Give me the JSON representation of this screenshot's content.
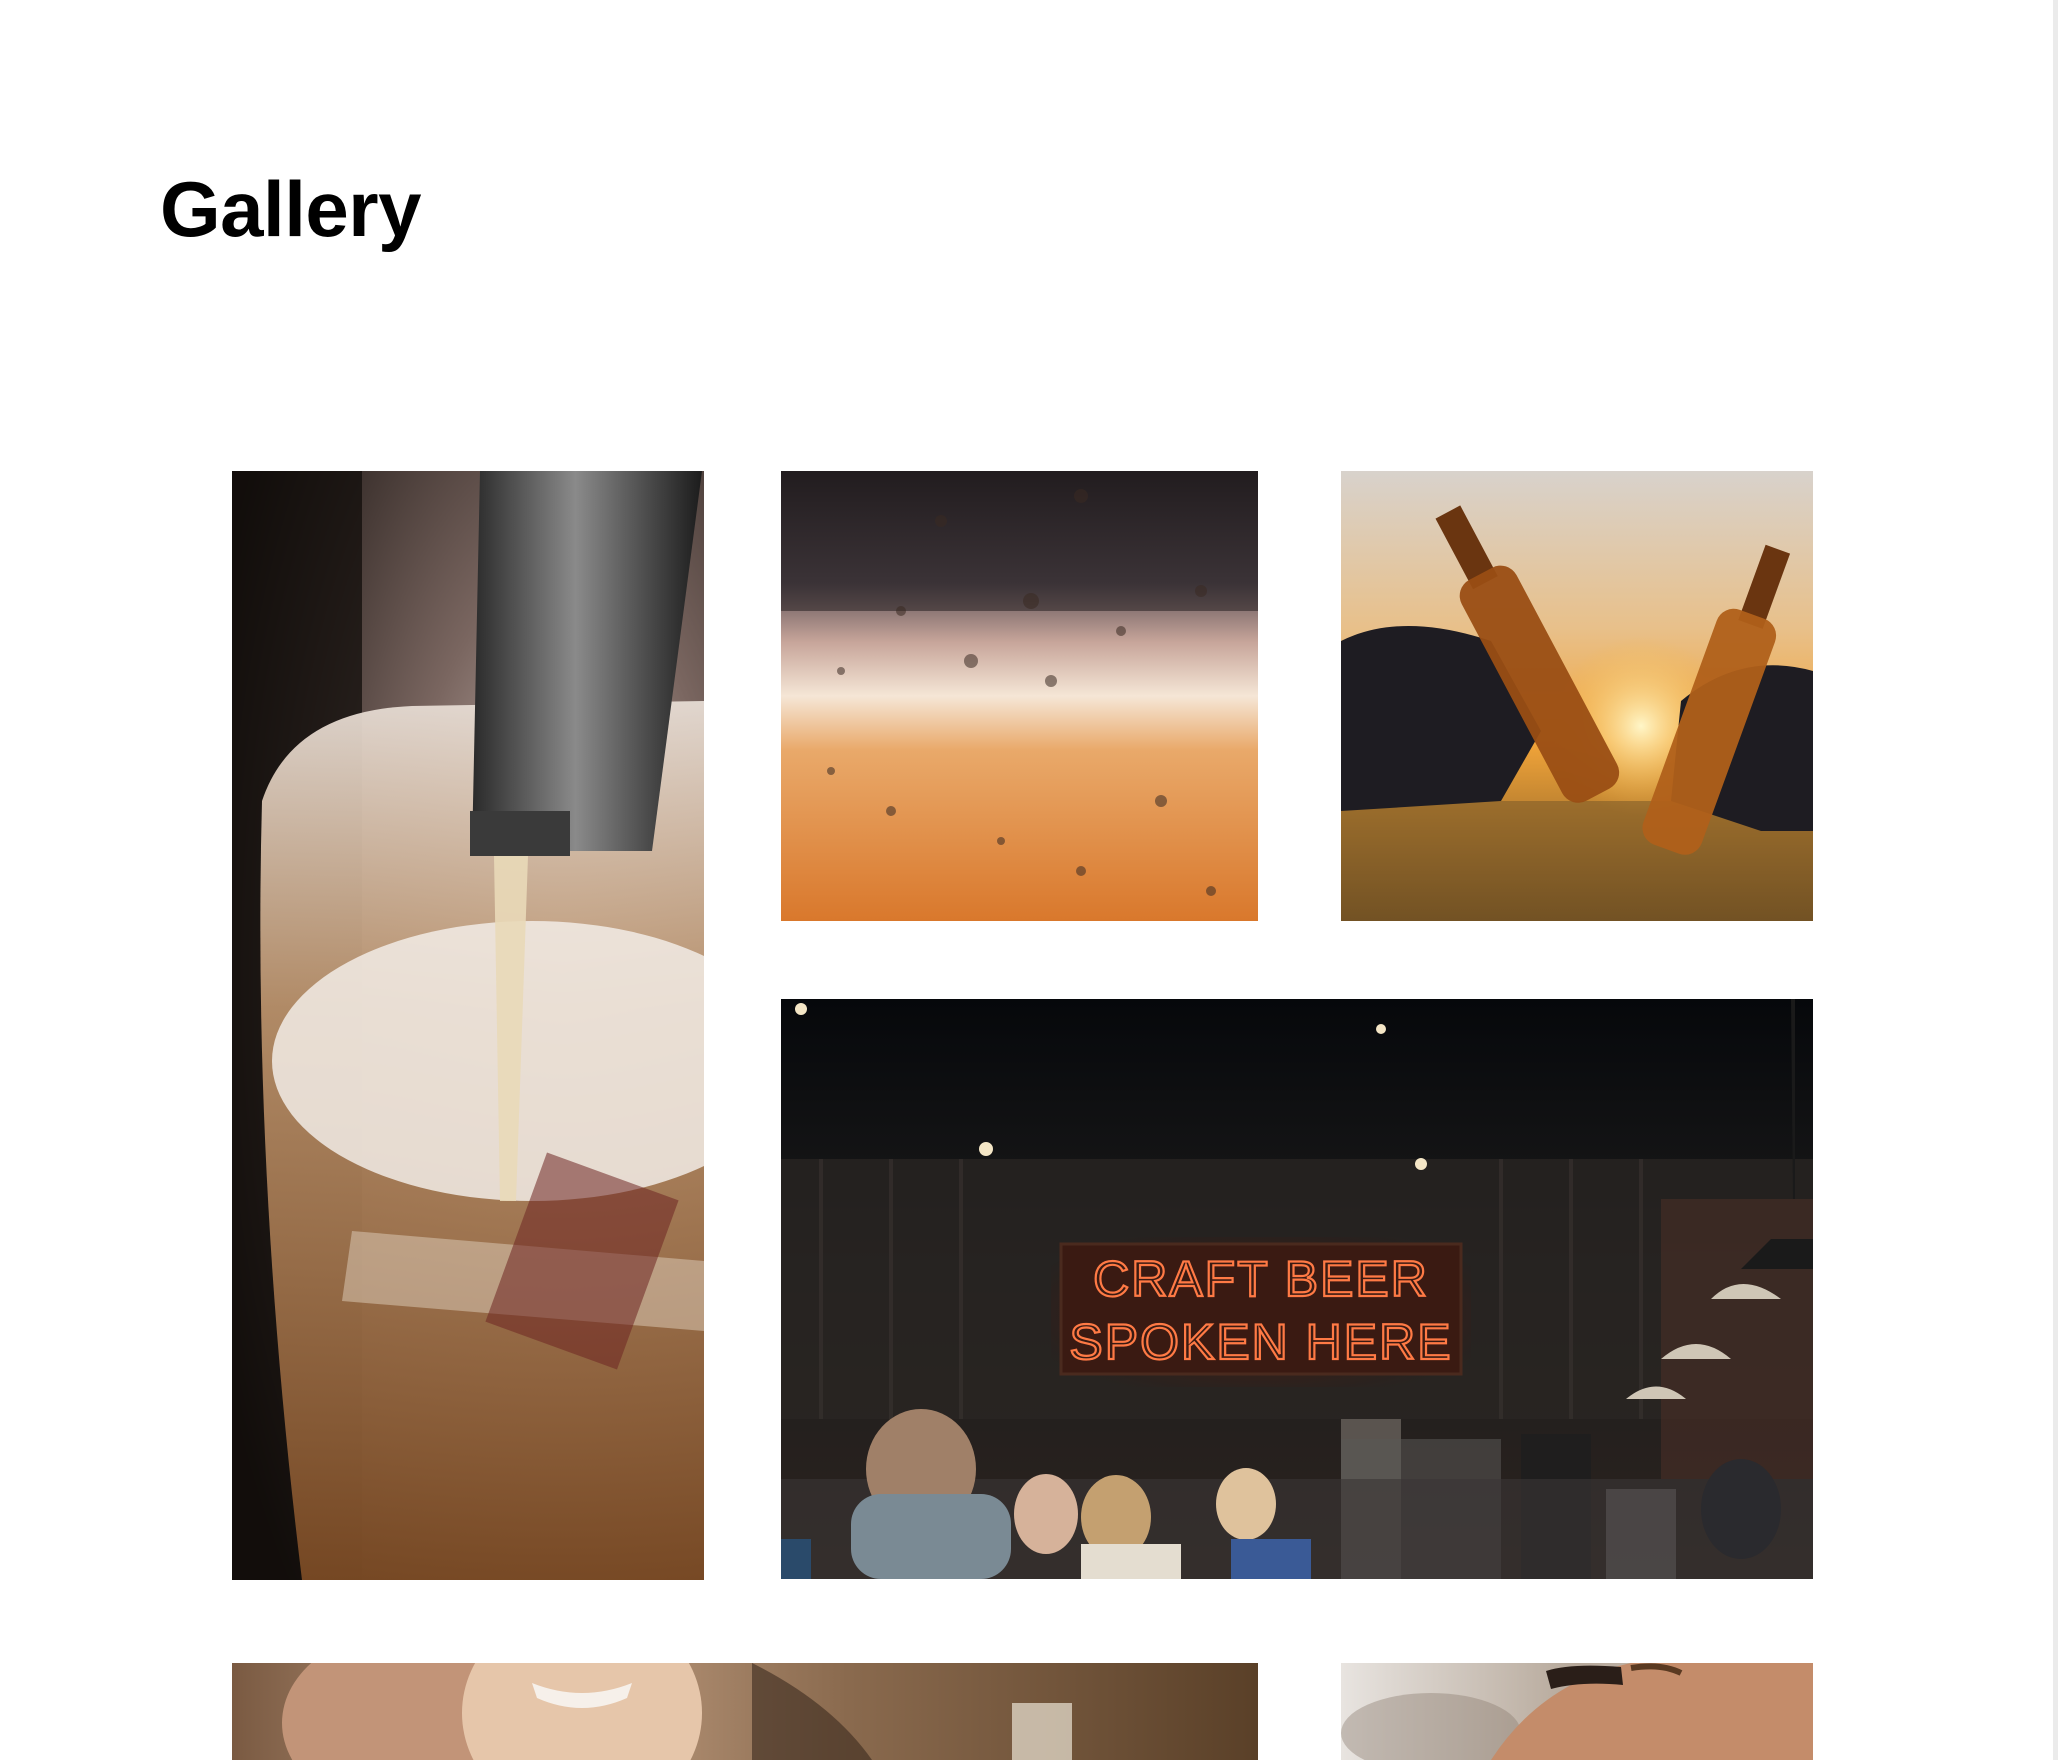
{
  "page": {
    "title": "Gallery"
  },
  "gallery": {
    "items": [
      {
        "name": "beer-tap-pouring-photo",
        "subject": "beer tap pouring into glass"
      },
      {
        "name": "beer-glass-condensation-photo",
        "subject": "cold beer glass with condensation"
      },
      {
        "name": "bottles-toast-sunset-photo",
        "subject": "two beer bottles toasting at sunset"
      },
      {
        "name": "craft-beer-bar-photo",
        "subject": "bar interior with neon sign",
        "sign_line_1": "CRAFT BEER",
        "sign_line_2": "SPOKEN HERE"
      },
      {
        "name": "smiling-woman-photo",
        "subject": "smiling woman holding a glass"
      },
      {
        "name": "hand-with-glass-photo",
        "subject": "hand reaching for a glass"
      }
    ]
  }
}
